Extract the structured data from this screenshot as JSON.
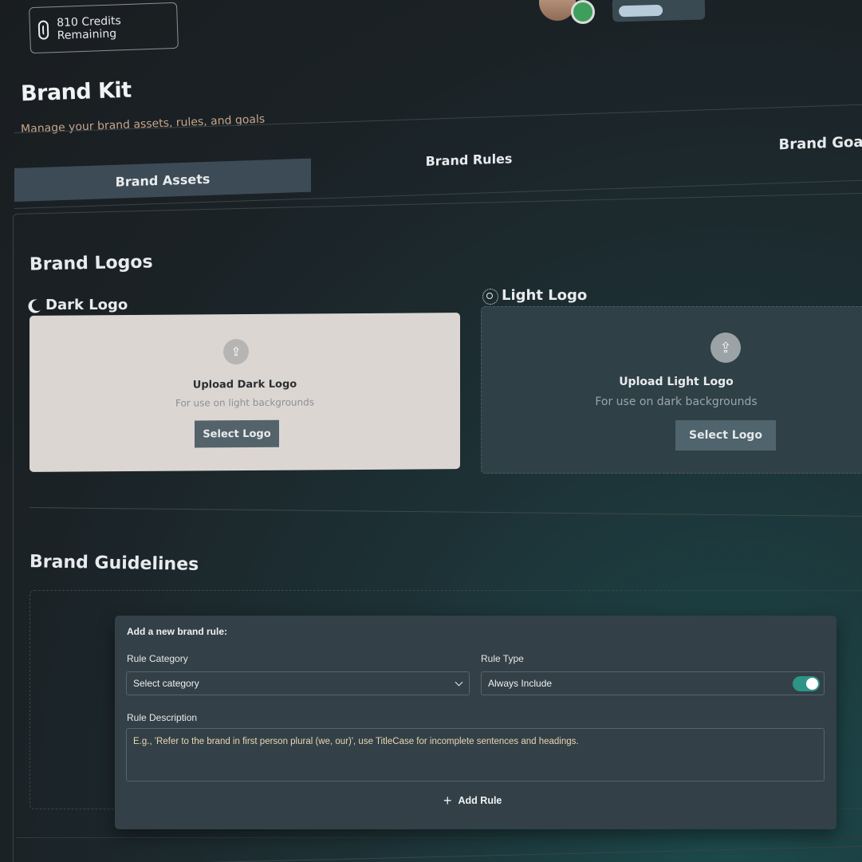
{
  "credits": {
    "label": "810 Credits Remaining"
  },
  "header": {
    "title": "Brand Kit",
    "subtitle": "Manage your brand assets, rules, and goals"
  },
  "tabs": [
    {
      "label": "Brand Assets",
      "active": true
    },
    {
      "label": "Brand Rules",
      "active": false
    },
    {
      "label": "Brand Goals",
      "active": false
    }
  ],
  "logos": {
    "title": "Brand Logos",
    "dark": {
      "label": "Dark Logo",
      "icon": "moon-icon",
      "upload_title": "Upload Dark Logo",
      "upload_desc": "For use on light backgrounds",
      "button": "Select Logo"
    },
    "light": {
      "label": "Light Logo",
      "icon": "sun-icon",
      "upload_title": "Upload Light Logo",
      "upload_desc": "For use on dark backgrounds",
      "button": "Select Logo"
    }
  },
  "guidelines": {
    "title": "Brand Guidelines"
  },
  "rule_form": {
    "heading": "Add a new brand rule:",
    "category_label": "Rule Category",
    "category_value": "Select category",
    "type_label": "Rule Type",
    "type_value": "Always Include",
    "type_toggle_on": true,
    "description_label": "Rule Description",
    "description_placeholder": "E.g., 'Refer to the brand in first person plural (we, our)', use TitleCase for incomplete sentences and headings.",
    "add_button": "Add Rule"
  },
  "colors": {
    "accent_toggle": "#2e9487",
    "status_online": "#3e9e5b",
    "subtitle": "#c9a58a"
  }
}
